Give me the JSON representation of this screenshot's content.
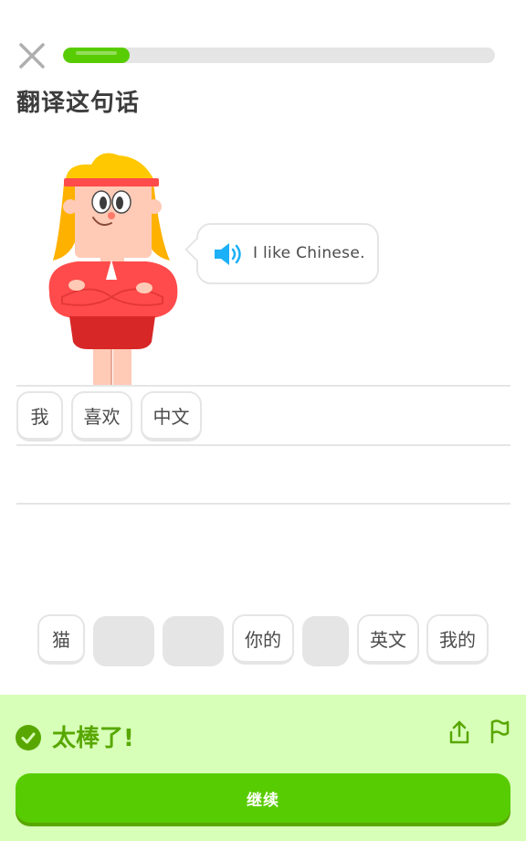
{
  "header": {
    "close_icon": "close-icon",
    "progress_fraction": 0.155
  },
  "prompt": {
    "title": "翻译这句话"
  },
  "speech": {
    "speaker_icon": "speaker-icon",
    "sentence": "I like Chinese."
  },
  "answer": {
    "selected_words": [
      "我",
      "喜欢",
      "中文"
    ]
  },
  "word_bank": {
    "tiles": [
      {
        "label": "猫",
        "used": false
      },
      {
        "label": "",
        "used": true
      },
      {
        "label": "",
        "used": true
      },
      {
        "label": "你的",
        "used": false
      },
      {
        "label": "",
        "used": true
      },
      {
        "label": "英文",
        "used": false
      },
      {
        "label": "我的",
        "used": false
      }
    ]
  },
  "feedback": {
    "check_icon": "check-circle-icon",
    "message": "太棒了!",
    "share_icon": "share-icon",
    "flag_icon": "flag-icon",
    "continue_label": "继续"
  },
  "colors": {
    "accent": "#58cc02",
    "accent_dark": "#58a700",
    "feedback_bg": "#d7ffb8",
    "speaker_blue": "#1cb0f6",
    "border": "#e5e5e5"
  }
}
